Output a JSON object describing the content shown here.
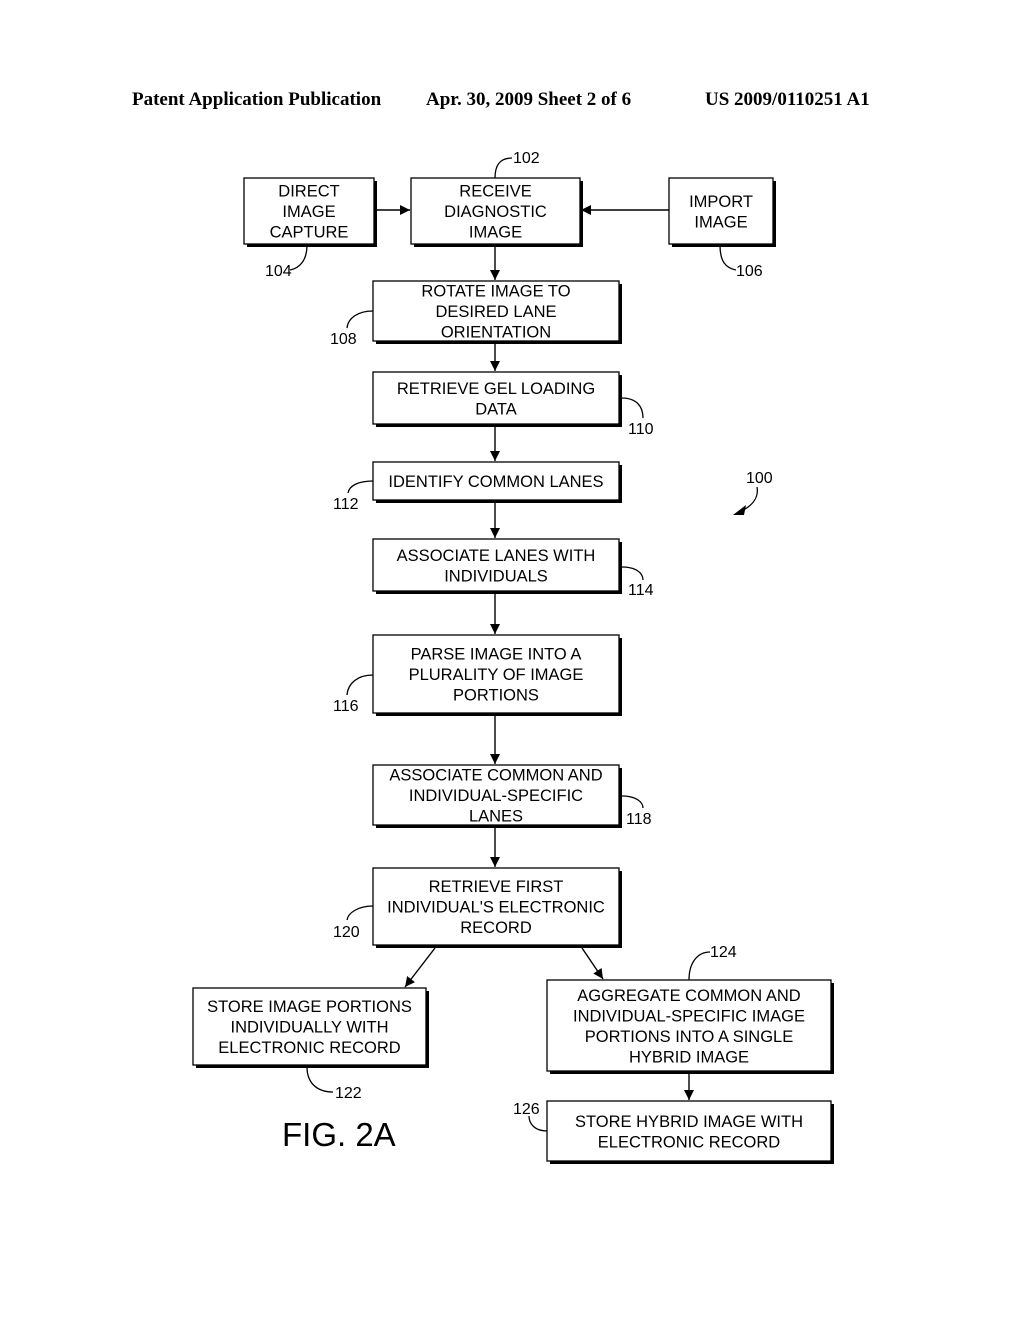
{
  "header": {
    "left": "Patent Application Publication",
    "middle": "Apr. 30, 2009  Sheet 2 of 6",
    "right": "US 2009/0110251 A1"
  },
  "figure_label": "FIG. 2A",
  "diagram_ref": "100",
  "boxes": [
    {
      "id": "direct",
      "ref": "104",
      "lines": [
        "DIRECT",
        "IMAGE",
        "CAPTURE"
      ]
    },
    {
      "id": "receive",
      "ref": "102",
      "lines": [
        "RECEIVE",
        "DIAGNOSTIC",
        "IMAGE"
      ]
    },
    {
      "id": "import",
      "ref": "106",
      "lines": [
        "IMPORT",
        "IMAGE"
      ]
    },
    {
      "id": "rotate",
      "ref": "108",
      "lines": [
        "ROTATE IMAGE TO",
        "DESIRED LANE",
        "ORIENTATION"
      ]
    },
    {
      "id": "retrieve-gel",
      "ref": "110",
      "lines": [
        "RETRIEVE GEL LOADING",
        "DATA"
      ]
    },
    {
      "id": "identify",
      "ref": "112",
      "lines": [
        "IDENTIFY COMMON LANES"
      ]
    },
    {
      "id": "associate-lanes",
      "ref": "114",
      "lines": [
        "ASSOCIATE LANES WITH",
        "INDIVIDUALS"
      ]
    },
    {
      "id": "parse",
      "ref": "116",
      "lines": [
        "PARSE IMAGE INTO A",
        "PLURALITY OF IMAGE",
        "PORTIONS"
      ]
    },
    {
      "id": "associate-common",
      "ref": "118",
      "lines": [
        "ASSOCIATE COMMON AND",
        "INDIVIDUAL-SPECIFIC",
        "LANES"
      ]
    },
    {
      "id": "retrieve-record",
      "ref": "120",
      "lines": [
        "RETRIEVE FIRST",
        "INDIVIDUAL'S ELECTRONIC",
        "RECORD"
      ]
    },
    {
      "id": "store-portions",
      "ref": "122",
      "lines": [
        "STORE IMAGE PORTIONS",
        "INDIVIDUALLY WITH",
        "ELECTRONIC RECORD"
      ]
    },
    {
      "id": "aggregate",
      "ref": "124",
      "lines": [
        "AGGREGATE COMMON AND",
        "INDIVIDUAL-SPECIFIC IMAGE",
        "PORTIONS INTO A SINGLE",
        "HYBRID IMAGE"
      ]
    },
    {
      "id": "store-hybrid",
      "ref": "126",
      "lines": [
        "STORE HYBRID IMAGE WITH",
        "ELECTRONIC RECORD"
      ]
    }
  ],
  "edges": [
    {
      "from": "direct",
      "to": "receive"
    },
    {
      "from": "import",
      "to": "receive"
    },
    {
      "from": "receive",
      "to": "rotate"
    },
    {
      "from": "rotate",
      "to": "retrieve-gel"
    },
    {
      "from": "retrieve-gel",
      "to": "identify"
    },
    {
      "from": "identify",
      "to": "associate-lanes"
    },
    {
      "from": "associate-lanes",
      "to": "parse"
    },
    {
      "from": "parse",
      "to": "associate-common"
    },
    {
      "from": "associate-common",
      "to": "retrieve-record"
    },
    {
      "from": "retrieve-record",
      "to": "store-portions"
    },
    {
      "from": "retrieve-record",
      "to": "aggregate"
    },
    {
      "from": "aggregate",
      "to": "store-hybrid"
    }
  ]
}
